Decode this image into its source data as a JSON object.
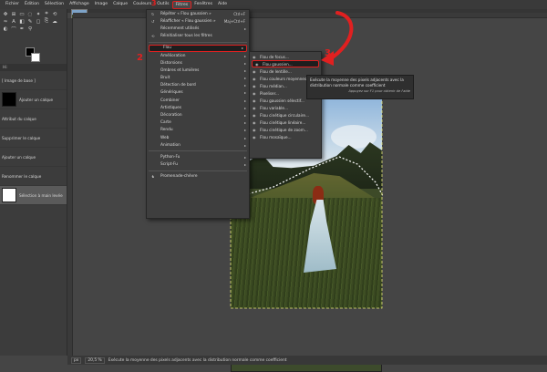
{
  "menubar": [
    "Fichier",
    "Édition",
    "Sélection",
    "Affichage",
    "Image",
    "Calque",
    "Couleurs",
    "Outils",
    "Filtres",
    "Fenêtres",
    "Aide"
  ],
  "active_menu_index": 8,
  "layers_header": "Hi",
  "history": [
    {
      "label": "[ Image de base ]",
      "thumb": "photo"
    },
    {
      "label": "Ajouter un calque",
      "thumb": "black"
    },
    {
      "label": "Attribut du calque",
      "thumb": "photo"
    },
    {
      "label": "Supprimer le calque",
      "thumb": "photo"
    },
    {
      "label": "Ajouter un calque",
      "thumb": "photo"
    },
    {
      "label": "Renommer le calque",
      "thumb": "photo"
    },
    {
      "label": "Sélection à main levée",
      "thumb": "white"
    }
  ],
  "filters_menu": {
    "repeat": {
      "label": "Répéter « Flou gaussien »",
      "shortcut": "Ctrl+F"
    },
    "reshow": {
      "label": "Réafficher « Flou gaussien »",
      "shortcut": "Maj+Ctrl+F"
    },
    "recent": "Récemment utilisés",
    "reset": "Réinitialiser tous les filtres",
    "blur": "Flou",
    "items": [
      "Amélioration",
      "Distorsions",
      "Ombres et lumières",
      "Bruit",
      "Détection de bord",
      "Génériques",
      "Combiner",
      "Artistiques",
      "Décoration",
      "Carte",
      "Rendu",
      "Web",
      "Animation"
    ],
    "scripts": [
      "Python-Fu",
      "Script-Fu"
    ],
    "gegl": "Promenade-chèvre"
  },
  "blur_submenu": [
    "Flou de focus...",
    "Flou gaussien...",
    "Flou de lentille...",
    "Flou couleurs moyennes...",
    "Flou médian...",
    "Pixeliser...",
    "Flou gaussien sélectif...",
    "Flou variable...",
    "Flou cinétique circulaire...",
    "Flou cinétique linéaire...",
    "Flou cinétique de zoom...",
    "Flou mosaïque..."
  ],
  "tooltip": {
    "text": "Exécute la moyenne des pixels adjacents avec la distribution normale comme coefficient",
    "help": "Appuyez sur F1 pour obtenir de l'aide"
  },
  "badges": {
    "menu": "3",
    "blur": "2",
    "gauss": "3"
  },
  "statusbar": {
    "unit": "px",
    "zoom": "20,5 %",
    "text": "Exécute la moyenne des pixels adjacents avec la distribution normale comme coefficient"
  },
  "colors": {
    "highlight": "#e02020",
    "menu_bg": "#3e3e3e",
    "app_bg": "#454545"
  }
}
